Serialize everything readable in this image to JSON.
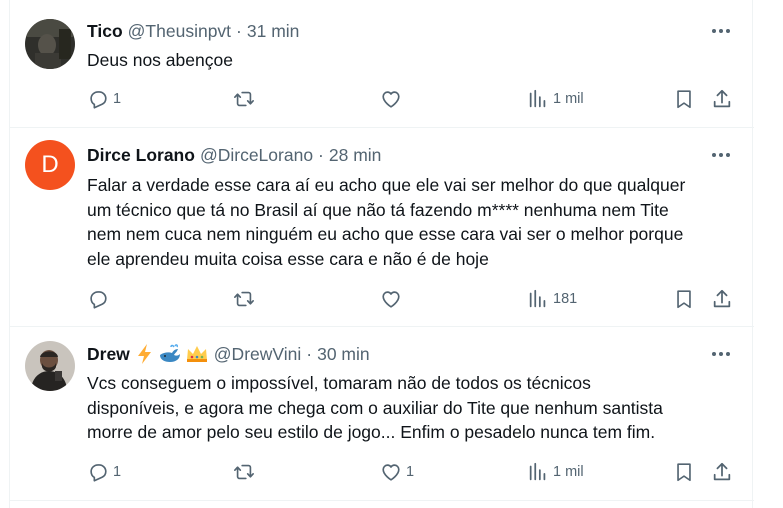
{
  "tweets": [
    {
      "name": "Tico",
      "handle": "@Theusinpvt",
      "separator": "·",
      "time": "31 min",
      "text": [
        "Deus nos abençoe"
      ],
      "replies": "1",
      "retweets": "",
      "likes": "",
      "views": "1 mil",
      "avatar": {
        "kind": "photo",
        "color": "#3a3a35"
      }
    },
    {
      "name": "Dirce Lorano",
      "handle": "@DirceLorano",
      "separator": "·",
      "time": "28 min",
      "text": [
        "Falar a verdade esse cara aí eu acho que ele vai ser melhor do que qualquer",
        "um técnico que tá no Brasil aí que não tá fazendo m**** nenhuma nem Tite",
        "nem nem cuca nem ninguém eu acho que esse cara vai ser o melhor porque",
        "ele aprendeu muita coisa esse cara e não é de hoje"
      ],
      "replies": "",
      "retweets": "",
      "likes": "",
      "views": "181",
      "avatar": {
        "kind": "letter",
        "letter": "D",
        "color": "#f4511e"
      }
    },
    {
      "name": "Drew",
      "emojis": [
        "lightning-emoji",
        "whale-emoji",
        "crown-emoji"
      ],
      "handle": "@DrewVini",
      "separator": "·",
      "time": "30 min",
      "text": [
        "Vcs conseguem o impossível, tomaram não de todos os técnicos",
        "disponíveis, e agora me chega com o auxiliar do Tite que nenhum santista",
        "morre de amor pelo seu estilo de jogo... Enfim o pesadelo nunca tem fim."
      ],
      "replies": "1",
      "retweets": "",
      "likes": "1",
      "views": "1 mil",
      "avatar": {
        "kind": "photo",
        "color": "#5b5651"
      }
    }
  ],
  "colors": {
    "secondary": "#536471",
    "primary": "#0f1419",
    "border": "#eff3f4"
  }
}
